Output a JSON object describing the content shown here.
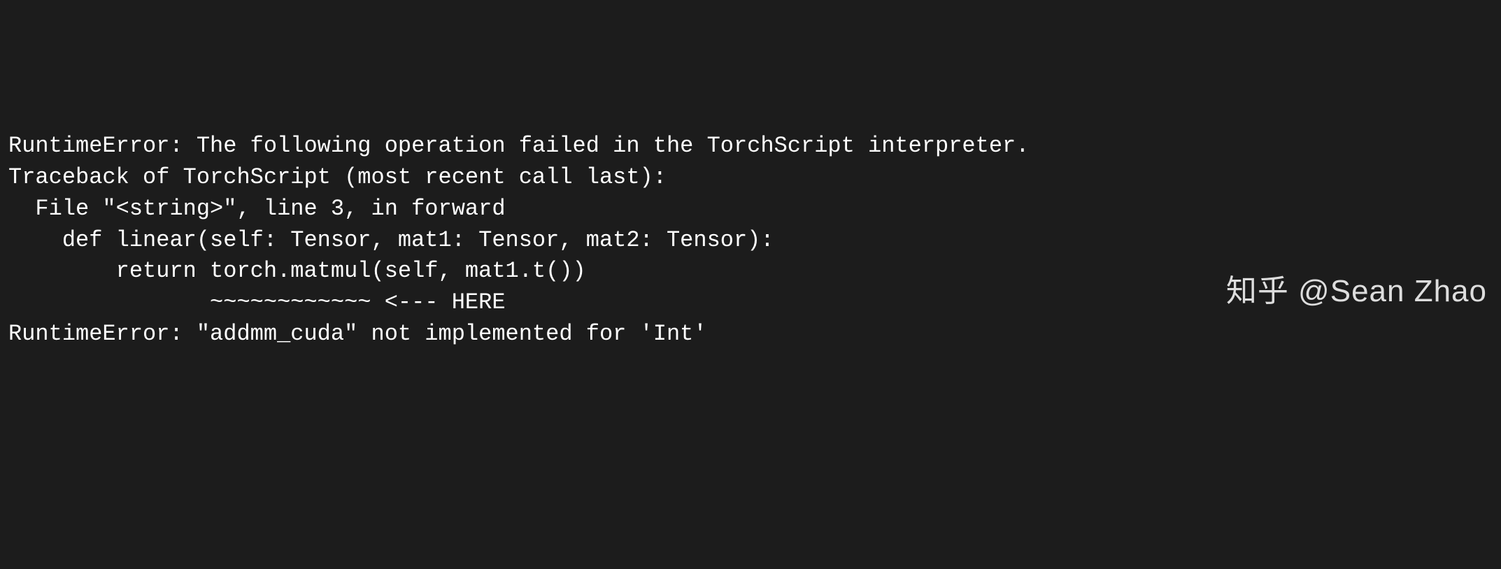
{
  "terminal": {
    "lines": [
      "RuntimeError: The following operation failed in the TorchScript interpreter.",
      "Traceback of TorchScript (most recent call last):",
      "  File \"<string>\", line 3, in forward",
      "",
      "    def linear(self: Tensor, mat1: Tensor, mat2: Tensor):",
      "        return torch.matmul(self, mat1.t())",
      "               ~~~~~~~~~~~~ <--- HERE",
      "",
      "RuntimeError: \"addmm_cuda\" not implemented for 'Int'"
    ]
  },
  "watermark": {
    "text": "知乎 @Sean Zhao"
  }
}
